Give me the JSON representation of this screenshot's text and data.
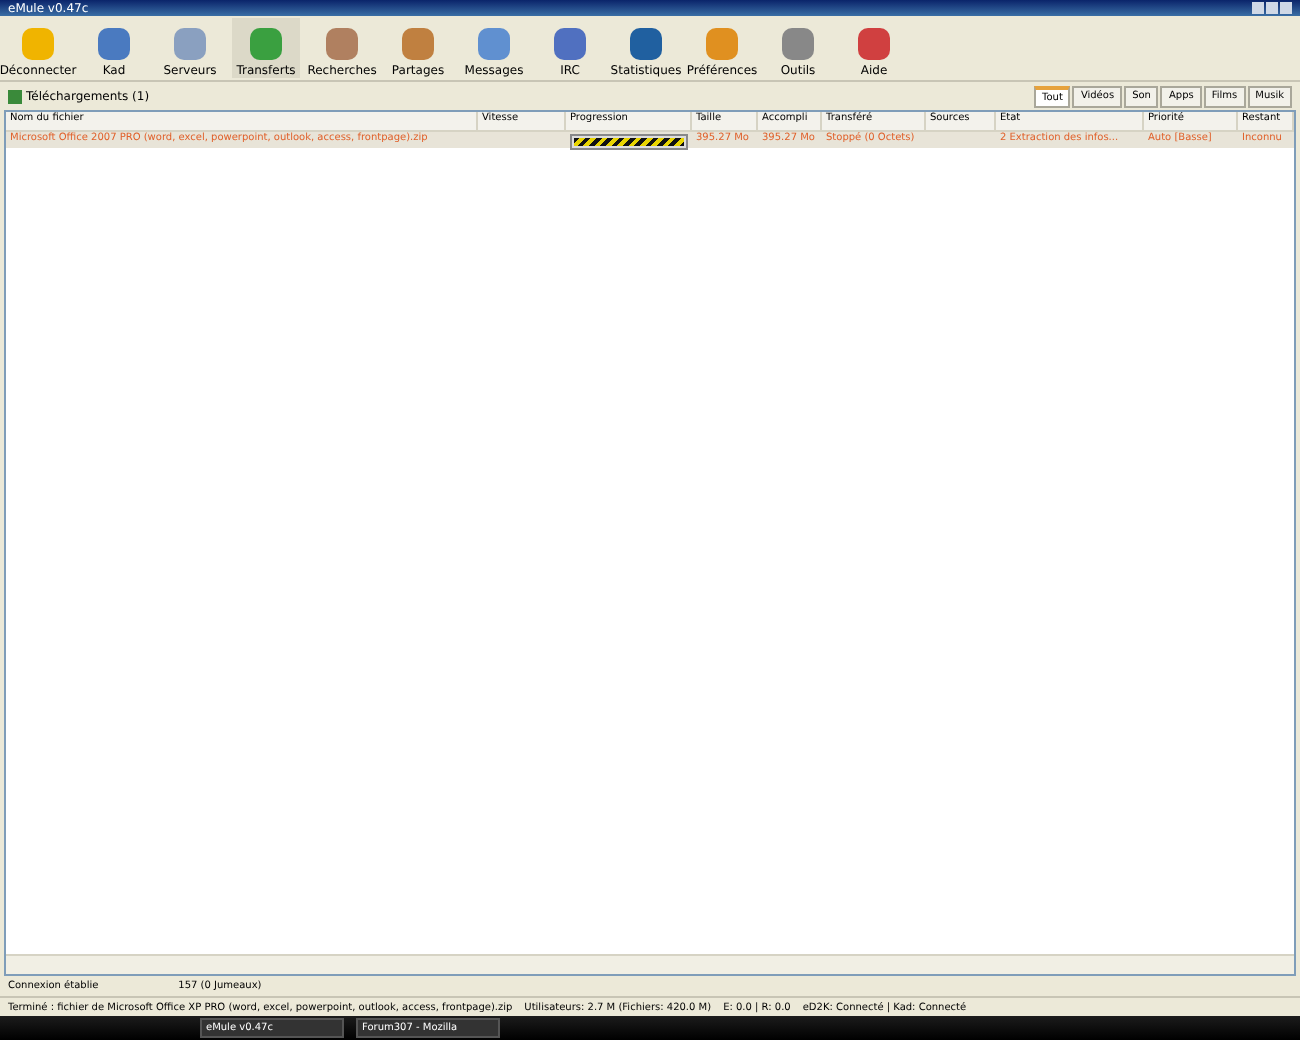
{
  "window": {
    "title": "eMule v0.47c"
  },
  "toolbar": [
    {
      "label": "Déconnecter",
      "selected": false
    },
    {
      "label": "Kad",
      "selected": false
    },
    {
      "label": "Serveurs",
      "selected": false
    },
    {
      "label": "Transferts",
      "selected": true
    },
    {
      "label": "Recherches",
      "selected": false
    },
    {
      "label": "Partages",
      "selected": false
    },
    {
      "label": "Messages",
      "selected": false
    },
    {
      "label": "IRC",
      "selected": false
    },
    {
      "label": "Statistiques",
      "selected": false
    },
    {
      "label": "Préférences",
      "selected": false
    },
    {
      "label": "Outils",
      "selected": false
    },
    {
      "label": "Aide",
      "selected": false
    }
  ],
  "downloads_header": {
    "label": "Téléchargements (1)"
  },
  "categories": [
    {
      "label": "Tout",
      "selected": true
    },
    {
      "label": "Vidéos",
      "selected": false
    },
    {
      "label": "Son",
      "selected": false
    },
    {
      "label": "Apps",
      "selected": false
    },
    {
      "label": "Films",
      "selected": false
    },
    {
      "label": "Musik",
      "selected": false
    }
  ],
  "table": {
    "columns": [
      "Nom du fichier",
      "Vitesse",
      "Progression",
      "Taille",
      "Accompli",
      "Transféré",
      "Sources",
      "Etat",
      "Priorité",
      "Restant"
    ],
    "rows": [
      {
        "cells": [
          "Microsoft Office 2007 PRO (word, excel, powerpoint, outlook, access, frontpage).zip",
          "",
          "",
          "395.27 Mo",
          "395.27 Mo",
          "Stoppé (0 Octets)",
          "",
          "2 Extraction des infos...",
          "Auto [Basse]",
          "Inconnu"
        ],
        "level": 1,
        "selected": true
      }
    ]
  },
  "status_bar": {
    "left": "Connexion établie",
    "right": "157 (0 Jumeaux)"
  },
  "bottom_bar": [
    "Terminé : fichier de Microsoft Office XP PRO (word, excel, powerpoint, outlook, access, frontpage).zip",
    "Utilisateurs: 2.7 M (Fichiers: 420.0 M)",
    "E: 0.0 | R: 0.0",
    "eD2K: Connecté | Kad: Connecté"
  ],
  "taskbar": [
    {
      "label": "eMule v0.47c"
    },
    {
      "label": "Forum307 - Mozilla"
    }
  ]
}
